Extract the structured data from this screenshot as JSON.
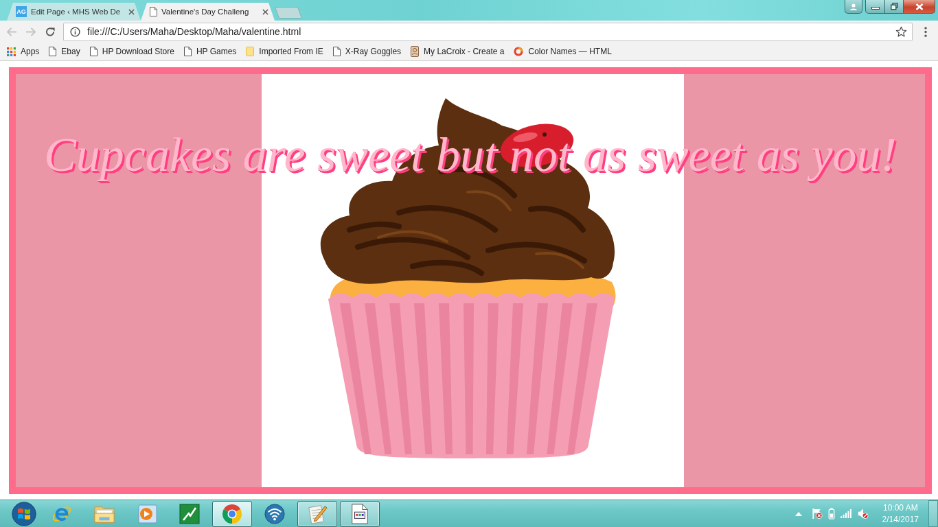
{
  "tabs": [
    {
      "favicon": "AG",
      "label": "Edit Page ‹ MHS Web De",
      "selected": false
    },
    {
      "label": "Valentine's Day Challeng",
      "selected": true
    }
  ],
  "toolbar": {
    "back_disabled": true,
    "forward_disabled": true,
    "url": "file:///C:/Users/Maha/Desktop/Maha/valentine.html"
  },
  "bookmarks": [
    {
      "kind": "apps",
      "label": "Apps"
    },
    {
      "kind": "page",
      "label": "Ebay"
    },
    {
      "kind": "page",
      "label": "HP Download Store"
    },
    {
      "kind": "page",
      "label": "HP Games"
    },
    {
      "kind": "folder",
      "label": "Imported From IE"
    },
    {
      "kind": "page",
      "label": "X-Ray Goggles"
    },
    {
      "kind": "portrait",
      "label": "My LaCroix - Create a"
    },
    {
      "kind": "ring",
      "label": "Color Names — HTML"
    }
  ],
  "page": {
    "heading": "Cupcakes are sweet but not as sweet as you!"
  },
  "taskbar": {
    "apps": [
      {
        "kind": "ie",
        "running": false,
        "selected": false
      },
      {
        "kind": "folder",
        "running": false,
        "selected": false
      },
      {
        "kind": "media",
        "running": false,
        "selected": false
      },
      {
        "kind": "lightning",
        "running": false,
        "selected": false
      },
      {
        "kind": "browser",
        "running": true,
        "selected": true
      },
      {
        "kind": "wifi",
        "running": false,
        "selected": false
      },
      {
        "kind": "notepad",
        "running": true,
        "selected": false
      },
      {
        "kind": "document",
        "running": true,
        "selected": false
      }
    ],
    "clock": {
      "time": "10:00 AM",
      "date": "2/14/2017"
    }
  }
}
